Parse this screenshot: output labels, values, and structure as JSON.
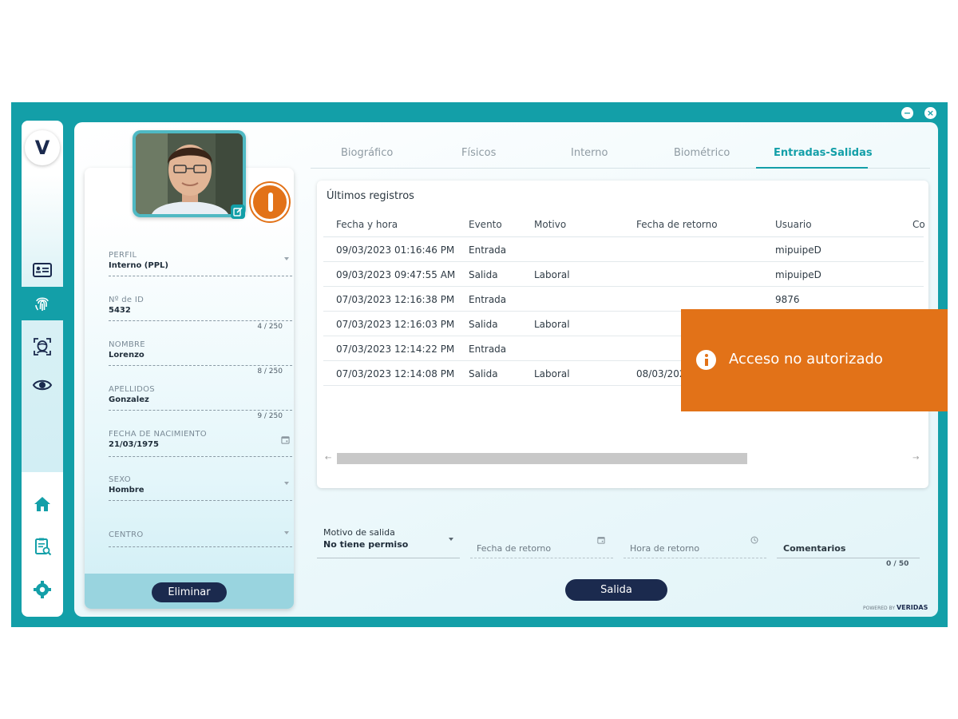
{
  "window": {
    "minimize_label": "−",
    "close_label": "×"
  },
  "rail": {
    "logo": "V",
    "items": [
      {
        "icon": "id-card-icon"
      },
      {
        "icon": "fingerprint-icon",
        "active": true
      },
      {
        "icon": "face-scan-icon"
      },
      {
        "icon": "eye-icon"
      }
    ],
    "bottom_items": [
      {
        "icon": "home-icon"
      },
      {
        "icon": "report-icon"
      },
      {
        "icon": "gear-icon"
      }
    ]
  },
  "profile": {
    "fields": [
      {
        "label": "PERFIL",
        "value": "Interno (PPL)",
        "counter": "",
        "type": "select"
      },
      {
        "label": "Nº de ID",
        "value": "5432",
        "counter": "4 / 250",
        "type": "text"
      },
      {
        "label": "NOMBRE",
        "value": "Lorenzo",
        "counter": "8 / 250",
        "type": "text"
      },
      {
        "label": "APELLIDOS",
        "value": "Gonzalez",
        "counter": "9 / 250",
        "type": "text"
      },
      {
        "label": "FECHA DE NACIMIENTO",
        "value": "21/03/1975",
        "counter": "",
        "type": "date"
      },
      {
        "label": "SEXO",
        "value": "Hombre",
        "counter": "",
        "type": "select"
      },
      {
        "label": "CENTRO",
        "value": "",
        "counter": "",
        "type": "select"
      }
    ],
    "delete_label": "Eliminar"
  },
  "tabs": [
    {
      "label": "Biográfico",
      "active": false
    },
    {
      "label": "Físicos",
      "active": false
    },
    {
      "label": "Interno",
      "active": false
    },
    {
      "label": "Biométrico",
      "active": false
    },
    {
      "label": "Entradas-Salidas",
      "active": true
    }
  ],
  "records": {
    "title": "Últimos registros",
    "columns": [
      "Fecha y hora",
      "Evento",
      "Motivo",
      "Fecha de retorno",
      "Usuario",
      "Co"
    ],
    "rows": [
      [
        "09/03/2023 01:16:46 PM",
        "Entrada",
        "",
        "",
        "mipuipeD"
      ],
      [
        "09/03/2023 09:47:55 AM",
        "Salida",
        "Laboral",
        "",
        "mipuipeD"
      ],
      [
        "07/03/2023 12:16:38 PM",
        "Entrada",
        "",
        "",
        "9876"
      ],
      [
        "07/03/2023 12:16:03 PM",
        "Salida",
        "Laboral",
        "",
        ""
      ],
      [
        "07/03/2023 12:14:22 PM",
        "Entrada",
        "",
        "",
        ""
      ],
      [
        "07/03/2023 12:14:08 PM",
        "Salida",
        "Laboral",
        "08/03/202",
        ""
      ]
    ]
  },
  "toast": {
    "message": "Acceso no autorizado"
  },
  "exit_form": {
    "reason_label": "Motivo de salida",
    "reason_value": "No tiene permiso",
    "return_date_placeholder": "Fecha de retorno",
    "return_time_placeholder": "Hora de retorno",
    "comments_placeholder": "Comentarios",
    "comments_counter": "0 / 50",
    "exit_label": "Salida"
  },
  "footer": {
    "powered_by": "POWERED BY",
    "brand": "VERIDAS"
  },
  "colors": {
    "teal": "#139fa8",
    "navy": "#1b2a4e",
    "orange": "#e27218"
  }
}
